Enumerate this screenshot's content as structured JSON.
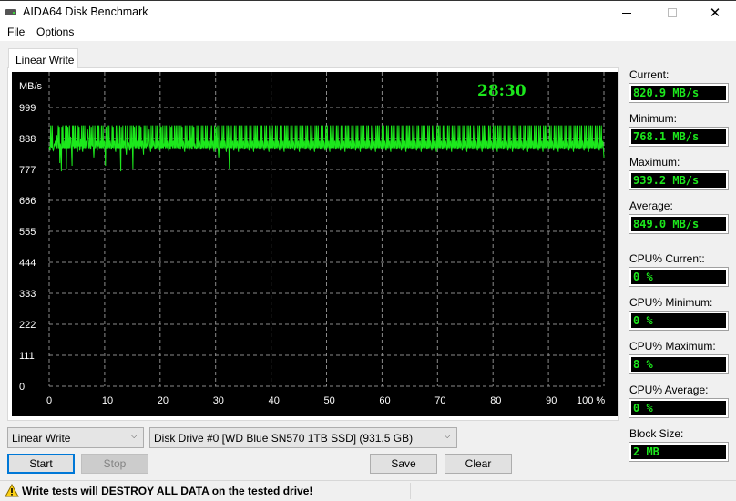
{
  "window": {
    "title": "AIDA64 Disk Benchmark",
    "controls": {
      "minimize": "minimize",
      "maximize": "maximize",
      "close": "close"
    }
  },
  "menu": {
    "items": [
      {
        "label": "File"
      },
      {
        "label": "Options"
      }
    ]
  },
  "tabs": [
    {
      "label": "Linear Write",
      "active": true
    }
  ],
  "timer": "28:30",
  "stats": [
    {
      "label": "Current:",
      "value": "820.9 MB/s"
    },
    {
      "label": "Minimum:",
      "value": "768.1 MB/s"
    },
    {
      "label": "Maximum:",
      "value": "939.2 MB/s"
    },
    {
      "label": "Average:",
      "value": "849.0 MB/s"
    },
    {
      "label": "CPU% Current:",
      "value": "0 %"
    },
    {
      "label": "CPU% Minimum:",
      "value": "0 %"
    },
    {
      "label": "CPU% Maximum:",
      "value": "8 %"
    },
    {
      "label": "CPU% Average:",
      "value": "0 %"
    },
    {
      "label": "Block Size:",
      "value": "2 MB"
    }
  ],
  "controls": {
    "test_select": "Linear Write",
    "drive_select": "Disk Drive #0  [WD Blue SN570 1TB SSD]  (931.5 GB)",
    "start": "Start",
    "stop": "Stop",
    "save": "Save",
    "clear": "Clear"
  },
  "status": {
    "warning": "Write tests will DESTROY ALL DATA on the tested drive!"
  },
  "colors": {
    "trace": "#1ce81c",
    "timer": "#1ce81c",
    "grid": "#8a8a8a",
    "background": "#000000"
  },
  "chart_data": {
    "type": "line",
    "title": "",
    "ylabel": "MB/s",
    "xlabel": "%",
    "ylim": [
      0,
      999
    ],
    "xlim": [
      0,
      100
    ],
    "y_ticks": [
      "0",
      "111",
      "222",
      "333",
      "444",
      "555",
      "666",
      "777",
      "888",
      "999"
    ],
    "x_ticks": [
      "0",
      "10",
      "20",
      "30",
      "40",
      "50",
      "60",
      "70",
      "80",
      "90",
      "100 %"
    ],
    "grid": true,
    "series": [
      {
        "name": "Linear Write",
        "x_start": 0,
        "x_end": 100,
        "values": [
          860,
          850,
          845,
          935,
          860,
          855,
          935,
          850,
          845,
          850,
          870,
          860,
          880,
          870,
          850,
          900,
          850,
          880,
          935,
          850,
          930,
          800,
          870,
          855,
          770,
          930,
          850,
          935,
          855,
          850,
          880,
          850,
          935,
          850,
          780,
          935,
          850,
          930,
          850,
          855,
          935,
          850,
          895,
          880,
          850,
          790,
          935,
          860,
          935,
          850,
          855,
          935,
          850,
          880,
          870,
          845,
          840,
          935,
          860,
          930,
          845,
          850,
          885,
          860,
          935,
          850,
          840,
          935,
          850,
          855,
          935,
          850,
          870,
          880,
          850,
          900,
          920,
          880,
          850,
          860,
          935,
          850,
          850,
          930,
          865,
          860,
          935,
          850,
          820,
          860,
          935,
          850,
          875,
          880,
          850,
          845,
          935,
          860,
          935,
          850,
          855,
          880,
          850,
          935,
          850,
          860,
          935,
          850,
          870,
          880,
          850,
          790,
          930,
          850,
          855,
          935,
          850,
          860,
          935,
          850,
          880,
          870,
          850,
          850,
          935,
          855,
          930,
          850,
          875,
          880,
          850,
          840,
          935,
          850,
          860,
          935,
          850,
          870,
          850,
          935,
          850,
          770,
          930,
          850,
          855,
          935,
          850,
          880,
          870,
          850,
          935,
          850,
          830,
          860,
          935,
          850,
          875,
          870,
          850,
          845,
          935,
          850,
          860,
          935,
          850,
          780,
          935,
          860,
          930,
          850,
          855,
          935,
          850,
          870,
          880,
          850,
          935,
          850,
          850,
          935,
          860,
          930,
          850,
          875,
          880,
          850,
          830,
          935,
          850,
          860,
          935,
          850,
          870,
          860,
          935,
          850,
          880,
          920,
          870,
          850,
          840,
          935,
          850,
          855,
          935,
          860,
          880,
          870,
          850,
          850,
          935,
          850,
          860,
          935,
          850,
          870,
          880,
          850,
          845,
          935,
          850,
          930,
          850,
          855,
          935,
          850,
          870,
          860,
          935,
          850,
          860,
          935,
          850,
          880,
          870,
          850,
          840,
          935,
          850,
          850,
          930,
          860,
          935,
          850,
          875,
          880,
          850,
          935,
          850,
          860,
          935,
          850,
          860,
          935,
          850,
          870,
          850,
          935,
          850,
          850,
          935,
          860,
          930,
          850,
          880,
          870,
          850,
          840,
          935,
          850,
          860,
          935,
          850,
          870,
          880,
          850,
          845,
          935,
          850,
          860,
          935,
          850,
          850,
          935,
          860,
          930,
          850,
          870,
          860,
          850,
          850,
          935,
          850,
          860,
          935,
          850,
          880,
          870,
          850,
          850,
          935,
          850,
          860,
          935,
          850,
          880,
          870,
          850,
          935,
          850,
          855,
          935,
          850,
          870,
          880,
          850,
          845,
          935,
          850,
          860,
          935,
          850,
          870,
          880,
          850,
          840,
          935,
          850,
          860,
          930,
          850,
          855,
          935,
          850,
          820,
          860,
          935,
          850,
          855,
          880,
          850,
          935,
          850,
          860,
          935,
          850,
          880,
          870,
          850,
          840,
          935,
          850,
          860,
          935,
          850,
          780,
          930,
          850,
          855,
          935,
          850,
          870,
          880,
          850,
          845,
          935,
          850,
          860,
          935,
          850,
          870,
          880,
          850,
          840,
          935,
          850,
          860,
          935,
          850,
          855,
          935,
          850,
          870,
          880,
          850,
          850,
          935,
          850,
          860,
          935,
          850,
          880,
          870,
          850,
          845,
          935,
          850,
          860,
          935,
          850,
          870,
          880,
          850,
          840,
          935,
          850,
          860,
          935,
          850,
          855,
          935,
          850,
          870,
          880,
          850,
          850,
          935,
          850,
          860,
          935,
          850,
          880,
          870,
          850,
          845,
          935,
          850,
          860,
          935,
          850,
          870,
          880,
          850,
          840,
          935,
          850,
          860,
          935,
          850,
          855,
          935,
          850,
          870,
          880,
          850,
          850,
          935,
          850,
          860,
          935,
          850,
          880,
          870,
          850,
          845,
          935,
          850,
          860,
          935,
          850,
          870,
          880,
          850,
          840,
          935,
          850,
          860,
          935,
          850,
          855,
          935,
          850,
          870,
          880,
          850,
          850,
          935,
          850,
          860,
          935,
          850,
          880,
          870,
          850,
          845,
          935,
          850,
          860,
          935,
          850,
          870,
          880,
          850,
          840,
          935,
          850,
          860,
          935,
          850,
          855,
          935,
          850,
          870,
          880,
          850,
          850,
          935,
          850,
          860,
          935,
          850,
          880,
          870,
          850,
          845,
          935,
          850,
          860,
          935,
          850,
          870,
          880,
          850,
          840,
          935,
          850,
          860,
          935,
          850,
          855,
          935,
          850,
          870,
          880,
          850,
          850,
          935,
          850,
          860,
          935,
          850,
          880,
          870,
          850,
          845,
          935,
          850,
          860,
          935,
          850,
          870,
          880,
          850,
          840,
          935,
          850,
          860,
          935,
          850,
          855,
          935,
          850,
          870,
          880,
          850,
          850,
          935,
          850,
          860,
          935,
          850,
          880,
          870,
          850,
          845,
          935,
          850,
          860,
          935,
          850,
          870,
          880,
          850,
          840,
          935,
          850,
          860,
          935,
          850,
          855,
          935,
          850,
          870,
          880,
          850,
          850,
          935,
          850,
          860,
          935,
          850,
          880,
          870,
          850,
          845,
          935,
          850,
          860,
          935,
          850,
          870,
          880,
          850,
          840,
          935,
          850,
          860,
          935,
          850,
          855,
          935,
          850,
          870,
          880,
          850,
          850,
          935,
          850,
          860,
          935,
          850,
          880,
          870,
          850,
          845,
          935,
          850,
          860,
          935,
          850,
          870,
          880,
          850,
          840,
          935,
          850,
          860,
          935,
          850,
          855,
          935,
          850,
          870,
          880,
          850,
          850,
          935,
          850,
          860,
          935,
          850,
          880,
          870,
          850,
          845,
          935,
          850,
          860,
          935,
          850,
          870,
          880,
          850,
          840,
          935,
          850,
          860,
          935,
          850,
          855,
          935,
          850,
          870,
          880,
          850,
          850,
          935,
          850,
          860,
          935,
          850,
          880,
          870,
          850,
          845,
          935,
          850,
          860,
          935,
          850,
          870,
          880,
          850,
          840,
          935,
          850,
          860,
          935,
          850,
          855,
          935,
          850,
          870,
          880,
          850,
          850,
          935,
          850,
          860,
          935,
          850,
          880,
          870,
          850,
          845,
          935,
          850,
          860,
          935,
          850,
          870,
          880,
          850,
          840,
          935,
          850,
          860,
          935,
          850,
          855,
          935,
          850,
          870,
          880,
          850,
          850,
          935,
          850,
          860,
          935,
          850,
          880,
          870,
          850,
          845,
          935,
          850,
          860,
          935,
          850,
          870,
          880,
          850,
          840,
          935,
          850,
          860,
          935,
          850,
          855,
          935,
          850,
          870,
          880,
          850,
          850,
          935,
          850,
          860,
          935,
          850,
          880,
          870,
          850,
          845,
          935,
          850,
          860,
          935,
          850,
          870,
          880,
          850,
          840,
          935,
          850,
          860,
          935,
          850,
          855,
          935,
          850,
          870,
          880,
          850,
          850,
          935,
          850,
          860,
          935,
          850,
          880,
          870,
          850,
          845,
          935,
          850,
          860,
          935,
          850,
          870,
          880,
          850,
          840,
          935,
          850,
          860,
          935,
          850,
          855,
          935,
          850,
          870,
          880,
          850,
          850,
          935,
          850,
          860,
          935,
          850,
          880,
          870,
          850,
          845,
          935,
          850,
          860,
          935,
          850,
          870,
          880,
          850,
          840,
          935,
          850,
          860,
          935,
          850,
          855,
          935,
          850,
          870,
          880,
          850,
          850,
          935,
          850,
          860,
          935,
          850,
          880,
          870,
          850,
          845,
          935,
          850,
          860,
          935,
          850,
          870,
          880,
          850,
          840,
          935,
          850,
          860,
          935,
          850,
          855,
          935,
          850,
          870,
          880,
          850,
          850,
          935,
          850,
          860,
          935,
          850,
          880,
          870,
          850,
          845,
          935,
          850,
          860,
          935,
          850,
          870,
          880,
          850,
          840,
          935,
          850,
          860,
          935,
          850,
          855,
          935,
          850,
          870,
          880,
          850,
          850,
          935,
          850,
          860,
          935,
          850,
          880,
          870,
          850,
          845,
          935,
          850,
          860,
          935,
          850,
          870,
          880,
          850,
          840,
          935,
          850,
          860,
          935,
          850,
          855,
          935,
          850,
          870,
          880,
          850,
          850,
          935,
          850,
          860,
          935,
          850,
          880,
          870,
          850,
          845,
          935,
          850,
          860,
          935,
          850,
          870,
          880,
          850,
          840,
          935,
          850,
          860,
          935,
          850,
          855,
          935,
          850,
          870,
          880,
          850,
          850,
          935,
          850,
          860,
          935,
          850,
          880,
          870,
          850,
          845,
          935,
          850,
          860,
          935,
          850,
          870,
          880,
          850,
          840,
          935,
          850,
          860,
          935,
          850,
          855,
          935,
          850,
          870,
          880,
          850,
          850,
          935,
          850,
          860,
          935,
          850,
          880,
          870,
          850,
          845,
          935,
          850,
          860,
          935,
          850,
          870,
          880,
          850,
          840,
          935,
          850,
          860,
          935,
          850,
          855,
          935,
          850,
          870,
          880,
          850,
          850,
          935,
          850,
          860,
          935,
          850,
          880,
          870,
          850,
          845,
          935,
          850,
          860,
          935,
          850,
          870,
          880,
          850,
          840,
          935,
          850,
          860,
          935,
          850,
          855,
          935,
          850,
          870,
          880,
          850,
          850,
          935,
          850,
          860,
          935,
          850,
          880,
          870,
          850,
          845,
          935,
          850,
          860,
          935,
          850,
          870,
          880,
          850,
          820
        ]
      }
    ]
  }
}
